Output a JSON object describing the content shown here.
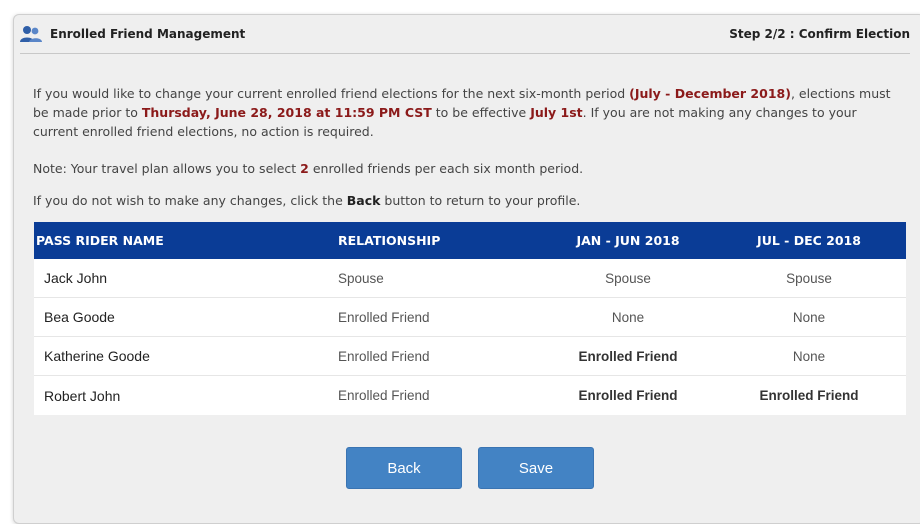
{
  "header": {
    "title": "Enrolled Friend Management",
    "step": "Step 2/2 : Confirm Election"
  },
  "intro": {
    "t1": "If you would like to change your current enrolled friend elections for the next six-month period ",
    "period": "(July - December 2018)",
    "t2": ", elections must be made prior to ",
    "deadline": "Thursday, June 28, 2018 at 11:59 PM CST",
    "t3": " to be effective ",
    "effective": "July 1st",
    "t4": ". If you are not making any changes to your current enrolled friend elections, no action is required."
  },
  "note": {
    "t1": "Note: Your travel plan allows you to select ",
    "count": "2",
    "t2": " enrolled friends per each six month period."
  },
  "instruction": {
    "t1": "If you do not wish to make any changes, click the ",
    "back_word": "Back",
    "t2": " button to return to your profile."
  },
  "table": {
    "headers": [
      "PASS RIDER NAME",
      "RELATIONSHIP",
      "JAN - JUN 2018",
      "JUL - DEC 2018"
    ],
    "rows": [
      {
        "name": "Jack John",
        "relationship": "Spouse",
        "jan_jun": "Spouse",
        "jul_dec": "Spouse"
      },
      {
        "name": "Bea Goode",
        "relationship": "Enrolled Friend",
        "jan_jun": "None",
        "jul_dec": "None"
      },
      {
        "name": "Katherine Goode",
        "relationship": "Enrolled Friend",
        "jan_jun": "Enrolled Friend",
        "jul_dec": "None"
      },
      {
        "name": "Robert John",
        "relationship": "Enrolled Friend",
        "jan_jun": "Enrolled Friend",
        "jul_dec": "Enrolled Friend"
      }
    ]
  },
  "buttons": {
    "back": "Back",
    "save": "Save"
  },
  "colors": {
    "header_bar": "#0a3c96",
    "highlight_text": "#8b1a1a",
    "button": "#4383c4"
  },
  "icons": {
    "header": "people-icon"
  }
}
